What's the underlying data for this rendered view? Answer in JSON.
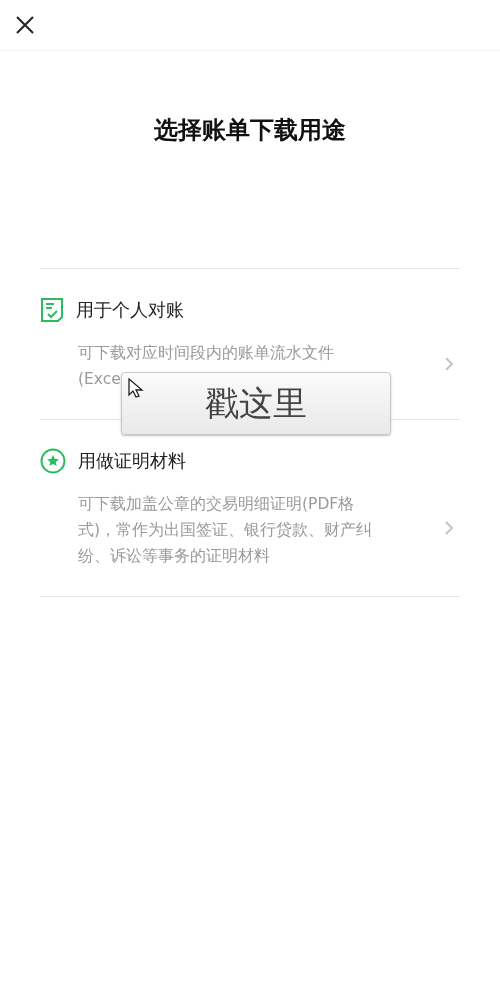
{
  "title": "选择账单下载用途",
  "options": [
    {
      "kind": "reconcile",
      "title": "用于个人对账",
      "description_lines": [
        "可下载对应时间段内的账单流水文件",
        "(Exce"
      ]
    },
    {
      "kind": "certificate",
      "title": "用做证明材料",
      "description_lines": [
        "可下载加盖公章的交易明细证明(PDF格",
        "式)，常作为出国签证、银行贷款、财产纠",
        "纷、诉讼等事务的证明材料"
      ]
    }
  ],
  "callout": {
    "text": "戳这里"
  }
}
